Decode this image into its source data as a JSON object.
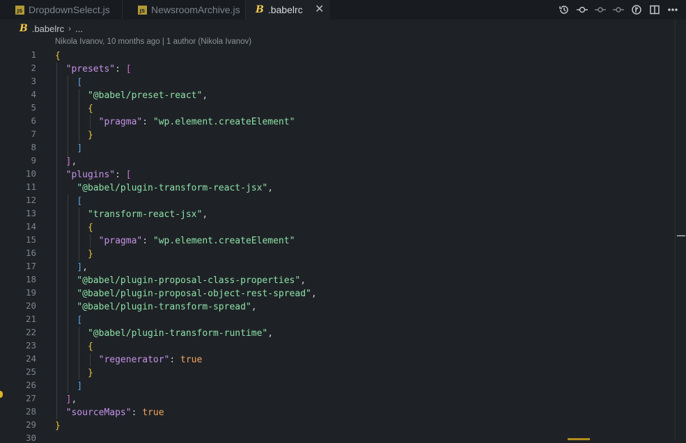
{
  "tabs": [
    {
      "label": "DropdownSelect.js",
      "icon": "js-file-icon",
      "badge": "JS",
      "active": false
    },
    {
      "label": "NewsroomArchive.js",
      "icon": "js-file-icon",
      "badge": "JS",
      "active": false
    },
    {
      "label": ".babelrc",
      "icon": "babel-file-icon",
      "badge": "B",
      "active": true
    }
  ],
  "tab_close_glyph": "✕",
  "toolbar_icons": [
    "history-icon",
    "git-commit-icon",
    "previous-change-icon",
    "next-change-icon",
    "git-lens-icon",
    "split-editor-icon",
    "more-actions-icon"
  ],
  "breadcrumb": {
    "file_badge": "B",
    "file": ".babelrc",
    "separator": "›",
    "ellipsis": "..."
  },
  "blame": "Nikola Ivanov, 10 months ago | 1 author (Nikola Ivanov)",
  "line_numbers": [
    "1",
    "2",
    "3",
    "4",
    "5",
    "6",
    "7",
    "8",
    "9",
    "10",
    "11",
    "12",
    "13",
    "14",
    "15",
    "16",
    "17",
    "18",
    "19",
    "20",
    "21",
    "22",
    "23",
    "24",
    "25",
    "26",
    "27",
    "28",
    "29",
    "30"
  ],
  "code_tokens": {
    "presets_key": "\"presets\"",
    "preset_react": "\"@babel/preset-react\"",
    "pragma_key": "\"pragma\"",
    "pragma_value": "\"wp.element.createElement\"",
    "plugins_key": "\"plugins\"",
    "transform_react_jsx_full": "\"@babel/plugin-transform-react-jsx\"",
    "transform_react_jsx": "\"transform-react-jsx\"",
    "class_properties": "\"@babel/plugin-proposal-class-properties\"",
    "object_rest_spread": "\"@babel/plugin-proposal-object-rest-spread\"",
    "transform_spread": "\"@babel/plugin-transform-spread\"",
    "transform_runtime": "\"@babel/plugin-transform-runtime\"",
    "regenerator_key": "\"regenerator\"",
    "true_value": "true",
    "sourcemaps_key": "\"sourceMaps\"",
    "colon": ": ",
    "comma": ",",
    "brace_open": "{",
    "brace_close": "}",
    "bracket_open": "[",
    "bracket_close": "]"
  },
  "colors": {
    "background": "#1e2226",
    "key": "#c792ea",
    "string": "#8ee0a8",
    "boolean": "#f3a560",
    "brace": "#f0c53f"
  }
}
